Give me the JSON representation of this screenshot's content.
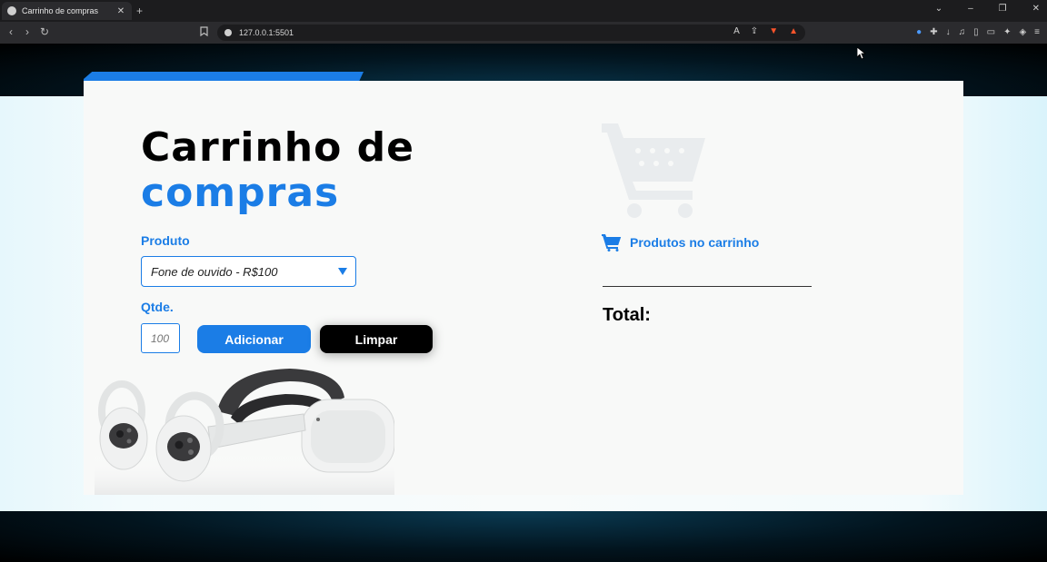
{
  "browser": {
    "tab_title": "Carrinho de compras",
    "tab_close": "✕",
    "new_tab": "+",
    "url": "127.0.0.1:5501",
    "back": "‹",
    "forward": "›",
    "reload": "↻",
    "controls": {
      "menu": "⌄",
      "minimize": "–",
      "restore": "❐",
      "close": "✕"
    }
  },
  "page": {
    "title_line1": "Carrinho de",
    "title_line2": "compras",
    "product_label": "Produto",
    "product_selected": "Fone de ouvido - R$100",
    "qty_label": "Qtde.",
    "qty_placeholder": "100",
    "add_button": "Adicionar",
    "clear_button": "Limpar",
    "cart_heading": "Produtos no carrinho",
    "total_label": "Total:"
  },
  "colors": {
    "accent": "#1b7de6",
    "card_bg": "#f8f9f8",
    "dark": "#000000"
  },
  "icons": {
    "cart_small": "shopping-cart-icon",
    "cart_watermark": "shopping-cart-icon",
    "vr_headset": "vr-headset-image"
  }
}
